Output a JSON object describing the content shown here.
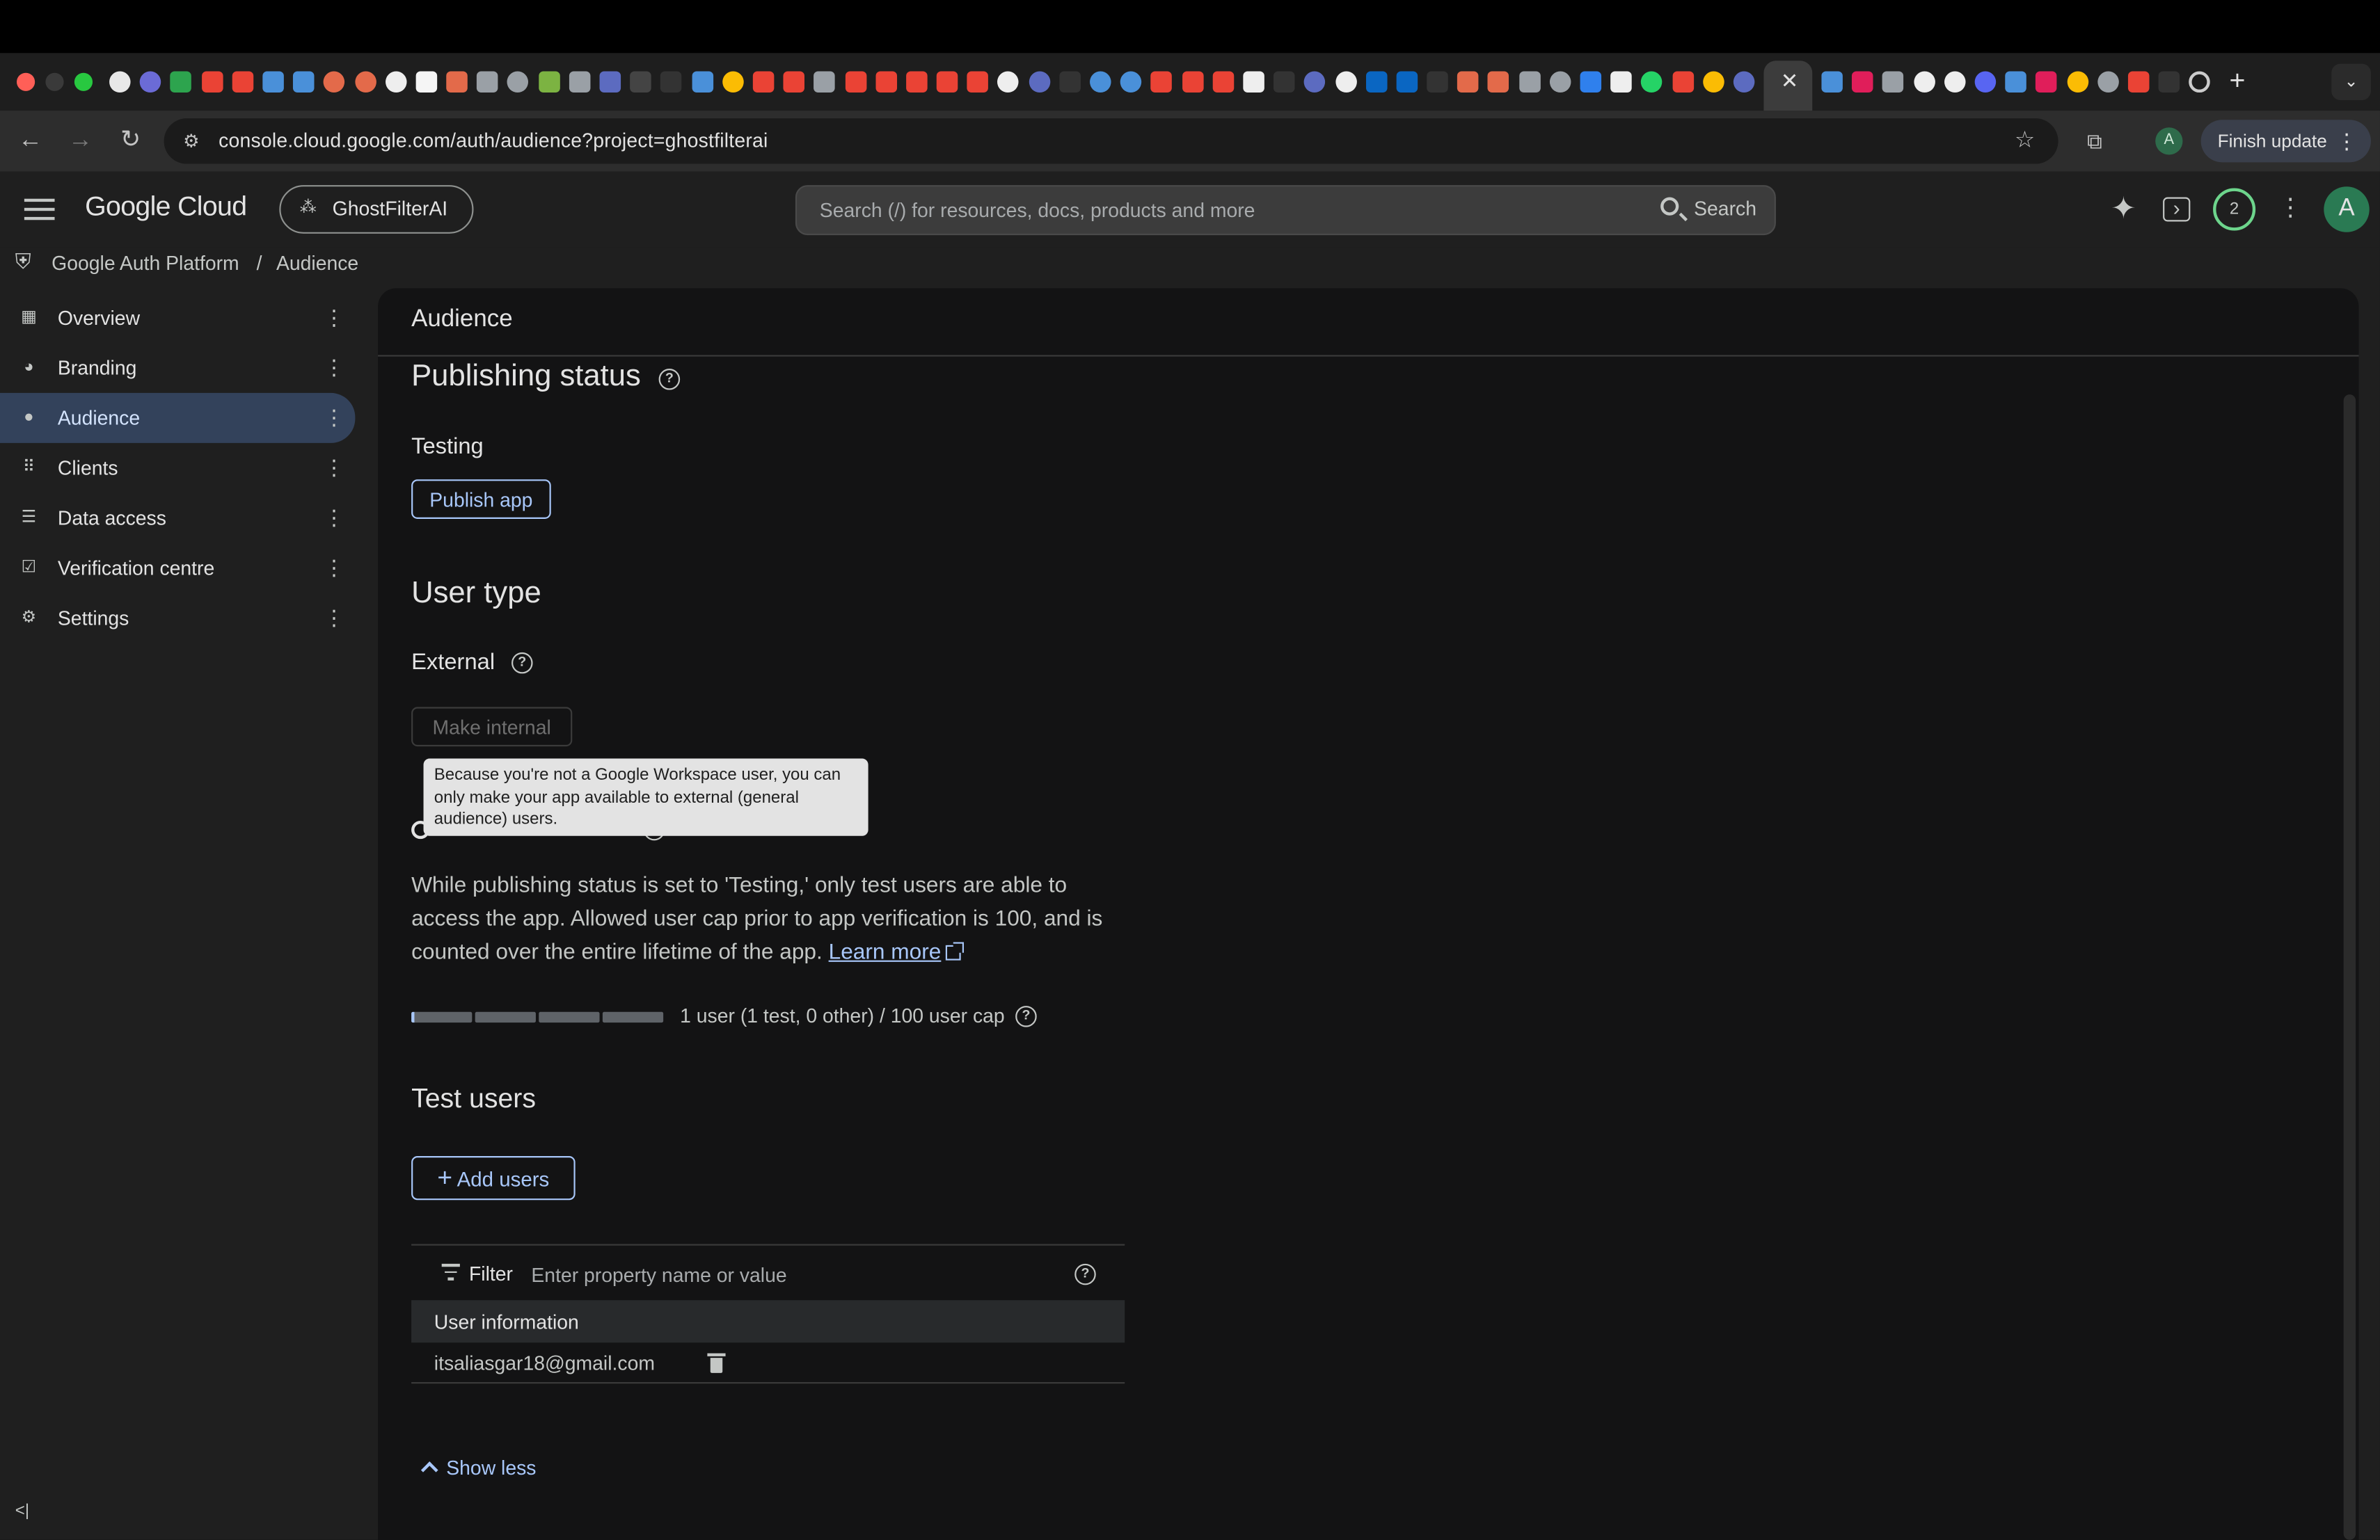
{
  "browser": {
    "url": "console.cloud.google.com/auth/audience?project=ghostfilterai",
    "finish_update": "Finish update",
    "profile_initial": "A",
    "tab_close": "✕",
    "new_tab": "+"
  },
  "header": {
    "brand": "Google Cloud",
    "project": "GhostFilterAI",
    "search_placeholder": "Search (/) for resources, docs, products and more",
    "search_button": "Search",
    "notifications_count": "2",
    "avatar_initial": "A"
  },
  "breadcrumb": {
    "root": "Google Auth Platform",
    "separator": "/",
    "current": "Audience"
  },
  "sidebar": {
    "items": [
      {
        "label": "Overview",
        "icon": "dashboard-icon"
      },
      {
        "label": "Branding",
        "icon": "palette-icon"
      },
      {
        "label": "Audience",
        "icon": "person-icon",
        "active": true
      },
      {
        "label": "Clients",
        "icon": "apps-grid-icon"
      },
      {
        "label": "Data access",
        "icon": "data-access-icon"
      },
      {
        "label": "Verification centre",
        "icon": "checkbox-icon"
      },
      {
        "label": "Settings",
        "icon": "gear-icon"
      }
    ]
  },
  "main": {
    "title": "Audience",
    "publishing": {
      "heading": "Publishing status",
      "status": "Testing",
      "publish_button": "Publish app"
    },
    "user_type": {
      "heading": "User type",
      "value": "External",
      "make_internal_button": "Make internal",
      "tooltip": "Because you're not a Google Workspace user, you can only make your app available to external (general audience) users."
    },
    "oauth_cap": {
      "description": "While publishing status is set to 'Testing,' only test users are able to access the app. Allowed user cap prior to app verification is 100, and is counted over the entire lifetime of the app.",
      "learn_more": "Learn more",
      "usage_text": "1 user (1 test, 0 other) / 100 user cap",
      "used": 1,
      "cap": 100
    },
    "test_users": {
      "heading": "Test users",
      "add_button": "Add users",
      "filter_label": "Filter",
      "filter_placeholder": "Enter property name or value",
      "column_header": "User information",
      "rows": [
        "itsaliasgar18@gmail.com"
      ],
      "show_less": "Show less"
    }
  },
  "colors": {
    "accent": "#a8c7fa",
    "active_nav": "#33425b",
    "panel_bg": "#131314",
    "page_bg": "#1f1f1f"
  }
}
